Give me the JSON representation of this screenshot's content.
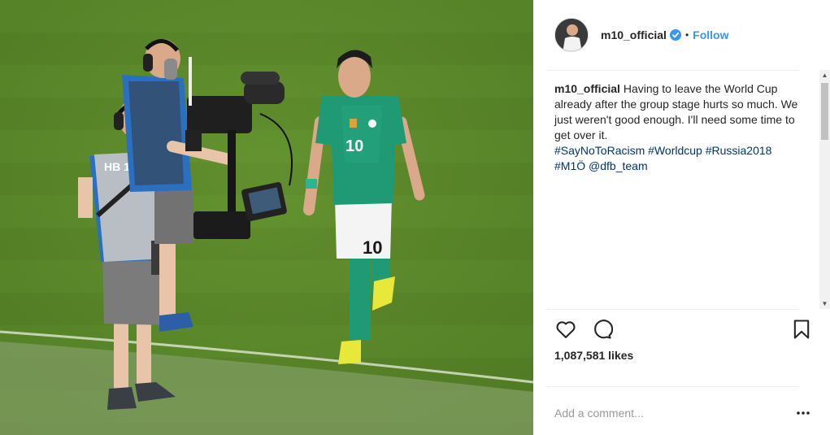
{
  "post": {
    "username": "m10_official",
    "separator": "•",
    "follow_label": "Follow",
    "caption_username": "m10_official",
    "caption_text": " Having to leave the World Cup already after the group stage hurts so much. We just weren't good enough. I'll need some time to get over it.",
    "hashtags": [
      "#SayNoToRacism",
      "#Worldcup",
      "#Russia2018",
      "#M1Ö",
      "@dfb_team"
    ],
    "likes": "1,087,581 likes",
    "comment_placeholder": "Add a comment..."
  },
  "photo": {
    "player_number": "10",
    "vest_text": "HB 11"
  },
  "icons": {
    "verified": "verified-badge-icon",
    "like": "heart-icon",
    "comment": "comment-bubble-icon",
    "save": "bookmark-icon",
    "more": "more-options-icon"
  },
  "colors": {
    "follow": "#3897f0",
    "hashtag": "#003569",
    "text": "#262626",
    "placeholder": "#999999",
    "grass": "#5d8a2b",
    "jersey": "#1f9a74"
  }
}
